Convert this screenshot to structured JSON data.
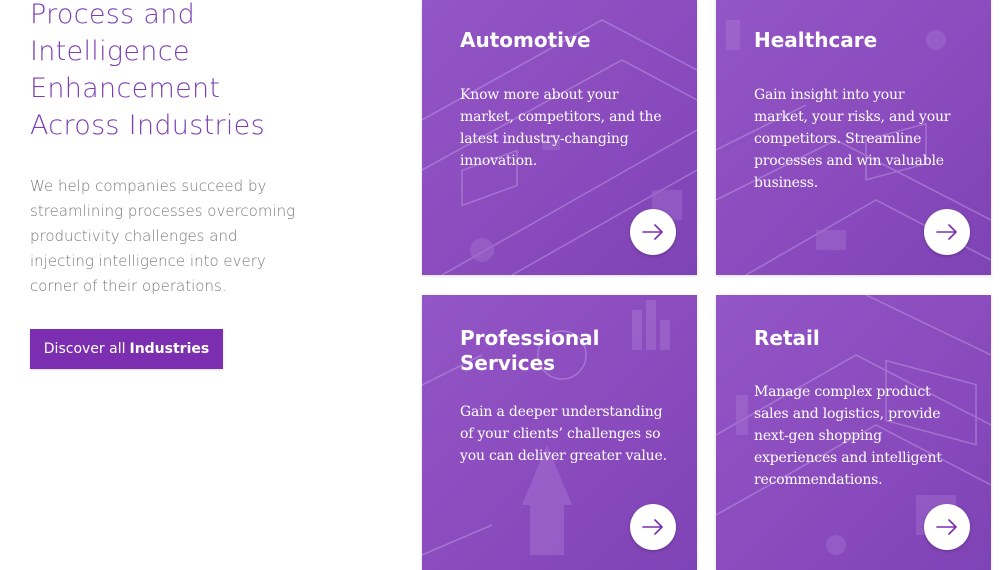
{
  "intro": {
    "heading_lines": [
      "Process and",
      "Intelligence",
      "Enhancement",
      "Across Industries"
    ],
    "description_lines": [
      "We help companies succeed by",
      "streamlining processes overcoming",
      "productivity challenges and",
      "injecting intelligence into every",
      "corner of their operations."
    ],
    "cta": {
      "prefix": "Discover all",
      "bold": "Industries"
    }
  },
  "cards": [
    {
      "title_lines": [
        "Automotive"
      ],
      "text_lines": [
        "Know more about your",
        "market, competitors, and the",
        "latest industry-changing",
        "innovation."
      ]
    },
    {
      "title_lines": [
        "Healthcare"
      ],
      "text_lines": [
        "Gain insight into your",
        "market, your risks, and your",
        "competitors. Streamline",
        "processes and win valuable",
        "business."
      ]
    },
    {
      "title_lines": [
        "Professional",
        "Services"
      ],
      "text_lines": [
        "Gain a deeper understanding",
        "of your clients’ challenges so",
        "you can deliver greater value."
      ]
    },
    {
      "title_lines": [
        "Retail"
      ],
      "text_lines": [
        "Manage complex product",
        "sales and logistics, provide",
        "next-gen shopping",
        "experiences and intelligent",
        "recommendations."
      ]
    }
  ],
  "colors": {
    "brand": "#7b2fb0",
    "heading": "#7b3fb3",
    "card": "#8a4bbd"
  },
  "icons": {
    "card_arrow": "arrow-right-icon"
  }
}
